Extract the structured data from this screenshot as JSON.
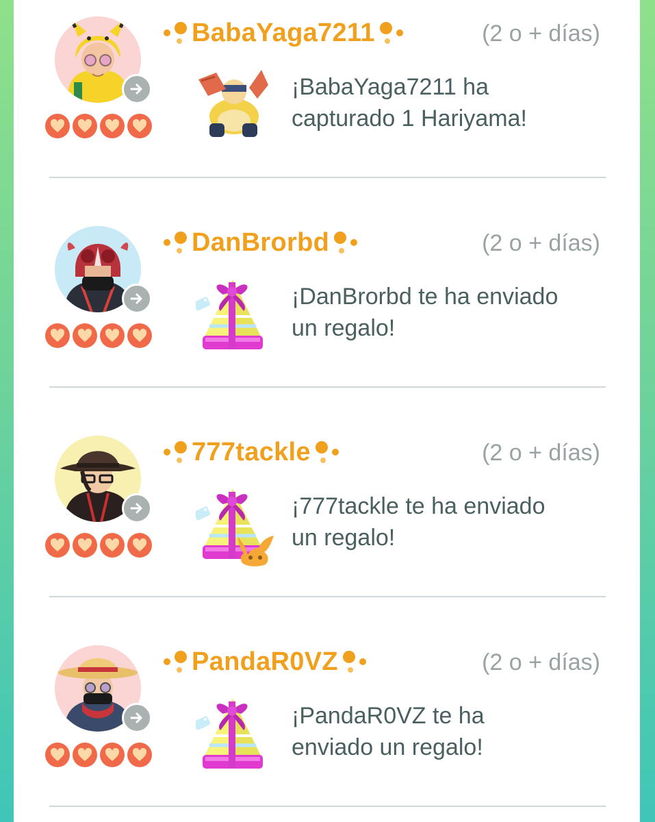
{
  "feed": [
    {
      "name": "BabaYaga7211",
      "time": "(2 o + días)",
      "message_line1": "¡BabaYaga7211 ha",
      "message_line2": "capturado 1 Hariyama!",
      "icon": "hariyama-pokemon-icon",
      "friendship_hearts": 4
    },
    {
      "name": "DanBrorbd",
      "time": "(2 o + días)",
      "message_line1": "¡DanBrorbd te ha enviado",
      "message_line2": "un regalo!",
      "icon": "gift-icon",
      "friendship_hearts": 4
    },
    {
      "name": "777tackle",
      "time": "(2 o + días)",
      "message_line1": "¡777tackle te ha enviado",
      "message_line2": "un regalo!",
      "icon": "gift-icon",
      "friendship_hearts": 4
    },
    {
      "name": "PandaR0VZ",
      "time": "(2 o + días)",
      "message_line1": "¡PandaR0VZ te ha",
      "message_line2": "enviado un regalo!",
      "icon": "gift-icon",
      "friendship_hearts": 4
    }
  ],
  "colors": {
    "name": "#f0a01c",
    "time": "#9aa3a3",
    "message": "#4a5f60",
    "heart_badge": "#f06a4a",
    "arrow_badge": "#a9b1b1",
    "divider": "#cfd8d8"
  }
}
